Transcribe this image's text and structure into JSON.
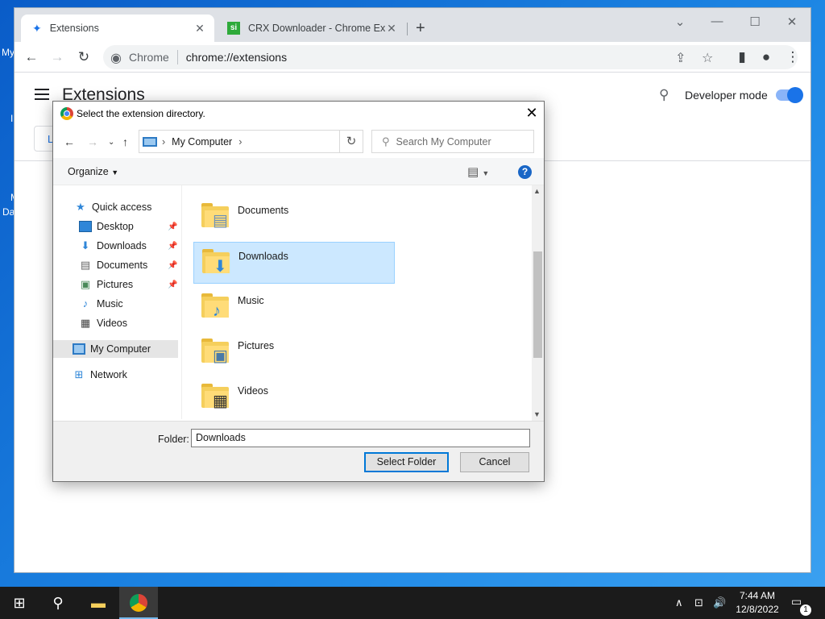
{
  "desktop": {
    "label_top": "My",
    "label_mid": "I",
    "label_mid2": "M",
    "label_low": "Da"
  },
  "chrome": {
    "tabs": [
      {
        "title": "Extensions",
        "icon": "puzzle-icon",
        "close": "✕"
      },
      {
        "title": "CRX Downloader - Chrome Exter",
        "icon": "si-favicon",
        "close": "✕",
        "favicon_text": "si"
      }
    ],
    "newtab": "+",
    "omnibox": {
      "site": "Chrome",
      "url": "chrome://extensions"
    },
    "page": {
      "title": "Extensions",
      "developer_mode_label": "Developer mode",
      "developer_mode_on": true,
      "load_button_stub": "L"
    }
  },
  "dialog": {
    "title": "Select the extension directory.",
    "address": {
      "location": "My Computer"
    },
    "search_placeholder": "Search My Computer",
    "organize_label": "Organize",
    "nav_pane": [
      {
        "label": "Quick access",
        "icon": "star-icon"
      },
      {
        "label": "Desktop",
        "icon": "desktop-icon",
        "pinned": true
      },
      {
        "label": "Downloads",
        "icon": "download-icon",
        "pinned": true
      },
      {
        "label": "Documents",
        "icon": "document-icon",
        "pinned": true
      },
      {
        "label": "Pictures",
        "icon": "picture-icon",
        "pinned": true
      },
      {
        "label": "Music",
        "icon": "music-icon"
      },
      {
        "label": "Videos",
        "icon": "video-icon"
      },
      {
        "label": "My Computer",
        "icon": "computer-icon",
        "selected": true
      },
      {
        "label": "Network",
        "icon": "network-icon"
      }
    ],
    "folders": [
      {
        "name": "Documents",
        "badge": "document-icon"
      },
      {
        "name": "Downloads",
        "badge": "download-icon",
        "selected": true
      },
      {
        "name": "Music",
        "badge": "music-icon"
      },
      {
        "name": "Pictures",
        "badge": "picture-icon"
      },
      {
        "name": "Videos",
        "badge": "video-icon"
      }
    ],
    "folder_label": "Folder:",
    "folder_value": "Downloads",
    "select_button": "Select Folder",
    "cancel_button": "Cancel"
  },
  "taskbar": {
    "time": "7:44 AM",
    "date": "12/8/2022",
    "notification_count": "1"
  },
  "colors": {
    "accent": "#1a73e8",
    "selection": "#cce8ff",
    "taskbar": "#1b1b1b"
  }
}
